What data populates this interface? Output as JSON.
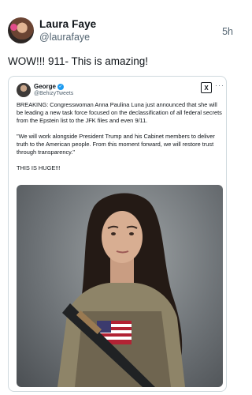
{
  "post": {
    "author_name": "Laura Faye",
    "author_handle": "@laurafaye",
    "time": "5h",
    "text": "WOW!!! 911- This is amazing!"
  },
  "quote": {
    "author_name": "George",
    "author_handle": "@BehizyTweets",
    "verified_icon": "check-badge-icon",
    "paragraphs": [
      "BREAKING: Congresswoman Anna Paulina Luna just announced that she will be leading a new task force focused on the declassification of all federal secrets from the Epstein list to the JFK files and even 9/11.",
      "\"We will work alongside President Trump and his Cabinet members to deliver truth to the American people. From this moment forward, we will restore trust through transparency.\"",
      "THIS IS HUGE!!!"
    ],
    "x_logo_text": "X",
    "more_text": "···"
  },
  "colors": {
    "text": "#0f1419",
    "secondary": "#536471",
    "border": "#cfd9de",
    "verified": "#1d9bf0"
  }
}
